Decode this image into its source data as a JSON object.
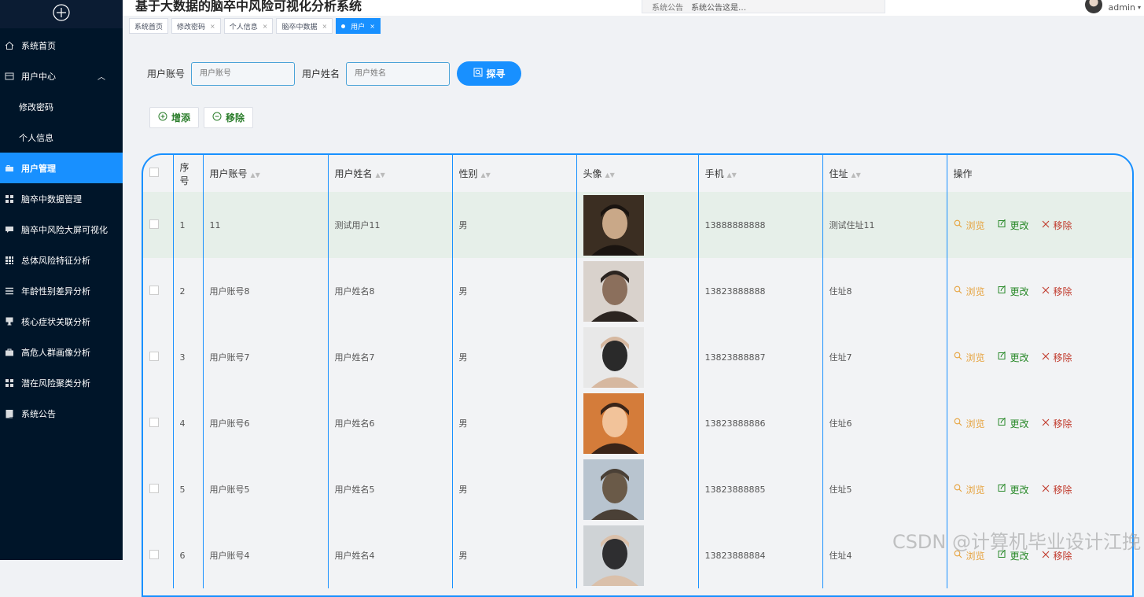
{
  "app": {
    "title": "基于大数据的脑卒中风险可视化分析系统",
    "notice_label": "系统公告",
    "notice_text": "系统公告这是…",
    "user_name": "admin"
  },
  "sidebar": {
    "items": [
      {
        "label": "系统首页",
        "icon": "home-icon"
      },
      {
        "label": "用户中心",
        "icon": "user-center-icon"
      },
      {
        "label": "修改密码",
        "icon": ""
      },
      {
        "label": "个人信息",
        "icon": ""
      },
      {
        "label": "用户管理",
        "icon": "user-manage-icon"
      },
      {
        "label": "脑卒中数据管理",
        "icon": "grid-icon"
      },
      {
        "label": "脑卒中风险大屏可视化",
        "icon": "chat-icon"
      },
      {
        "label": "总体风险特征分析",
        "icon": "grid-icon"
      },
      {
        "label": "年龄性别差异分析",
        "icon": "list-icon"
      },
      {
        "label": "核心症状关联分析",
        "icon": "cup-icon"
      },
      {
        "label": "高危人群画像分析",
        "icon": "briefcase-icon"
      },
      {
        "label": "潜在风险聚类分析",
        "icon": "grid-icon"
      },
      {
        "label": "系统公告",
        "icon": "book-icon"
      }
    ]
  },
  "tabs": [
    {
      "label": "系统首页",
      "closable": false
    },
    {
      "label": "修改密码",
      "closable": true
    },
    {
      "label": "个人信息",
      "closable": true
    },
    {
      "label": "脑卒中数据",
      "closable": true
    },
    {
      "label": "用户",
      "closable": true,
      "active": true
    }
  ],
  "search": {
    "account_label": "用户账号",
    "account_placeholder": "用户账号",
    "name_label": "用户姓名",
    "name_placeholder": "用户姓名",
    "button_label": "探寻"
  },
  "actions": {
    "add_label": "增添",
    "remove_label": "移除"
  },
  "table": {
    "headers": [
      "序号",
      "用户账号",
      "用户姓名",
      "性别",
      "头像",
      "手机",
      "住址",
      "操作"
    ],
    "ops": {
      "view": "浏览",
      "edit": "更改",
      "delete": "移除"
    },
    "rows": [
      {
        "index": "1",
        "account": "11",
        "name": "测试用户11",
        "gender": "男",
        "phone": "13888888888",
        "address": "测试住址11"
      },
      {
        "index": "2",
        "account": "用户账号8",
        "name": "用户姓名8",
        "gender": "男",
        "phone": "13823888888",
        "address": "住址8"
      },
      {
        "index": "3",
        "account": "用户账号7",
        "name": "用户姓名7",
        "gender": "男",
        "phone": "13823888887",
        "address": "住址7"
      },
      {
        "index": "4",
        "account": "用户账号6",
        "name": "用户姓名6",
        "gender": "男",
        "phone": "13823888886",
        "address": "住址6"
      },
      {
        "index": "5",
        "account": "用户账号5",
        "name": "用户姓名5",
        "gender": "男",
        "phone": "13823888885",
        "address": "住址5"
      },
      {
        "index": "6",
        "account": "用户账号4",
        "name": "用户姓名4",
        "gender": "男",
        "phone": "13823888884",
        "address": "住址4"
      }
    ]
  },
  "watermark": "CSDN @计算机毕业设计江挽",
  "colors": {
    "accent": "#1890ff",
    "sidebar_bg": "#001529",
    "view": "#e6a23c",
    "edit": "#2a8a2a",
    "delete": "#c0392b"
  }
}
